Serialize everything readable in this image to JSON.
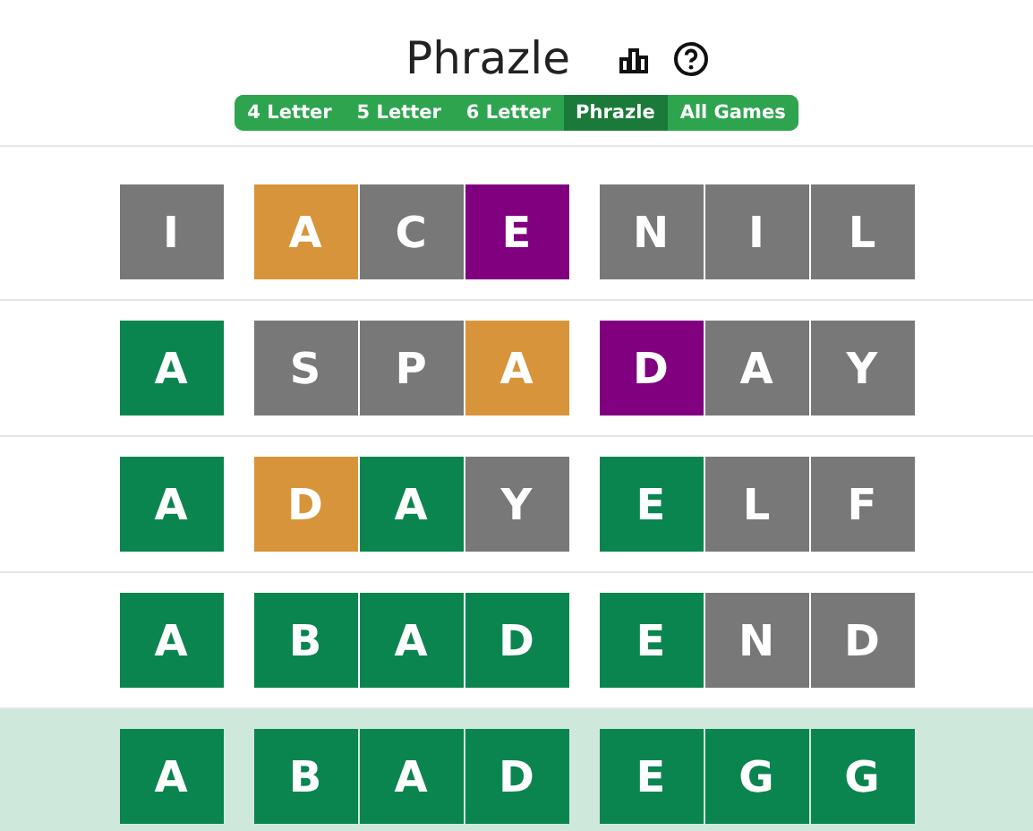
{
  "title": "Phrazle",
  "tabs": [
    {
      "label": "4 Letter",
      "selected": false
    },
    {
      "label": "5 Letter",
      "selected": false
    },
    {
      "label": "6 Letter",
      "selected": false
    },
    {
      "label": "Phrazle",
      "selected": true
    },
    {
      "label": "All Games",
      "selected": false
    }
  ],
  "rows": [
    {
      "selected": false,
      "words": [
        [
          {
            "letter": "I",
            "color": "#787878"
          }
        ],
        [
          {
            "letter": "A",
            "color": "#d8943a"
          },
          {
            "letter": "C",
            "color": "#787878"
          },
          {
            "letter": "E",
            "color": "#800080"
          }
        ],
        [
          {
            "letter": "N",
            "color": "#787878"
          },
          {
            "letter": "I",
            "color": "#787878"
          },
          {
            "letter": "L",
            "color": "#787878"
          }
        ]
      ]
    },
    {
      "selected": false,
      "words": [
        [
          {
            "letter": "A",
            "color": "#0a8550"
          }
        ],
        [
          {
            "letter": "S",
            "color": "#787878"
          },
          {
            "letter": "P",
            "color": "#787878"
          },
          {
            "letter": "A",
            "color": "#d8943a"
          }
        ],
        [
          {
            "letter": "D",
            "color": "#800080"
          },
          {
            "letter": "A",
            "color": "#787878"
          },
          {
            "letter": "Y",
            "color": "#787878"
          }
        ]
      ]
    },
    {
      "selected": false,
      "words": [
        [
          {
            "letter": "A",
            "color": "#0a8550"
          }
        ],
        [
          {
            "letter": "D",
            "color": "#d8943a"
          },
          {
            "letter": "A",
            "color": "#0a8550"
          },
          {
            "letter": "Y",
            "color": "#787878"
          }
        ],
        [
          {
            "letter": "E",
            "color": "#0a8550"
          },
          {
            "letter": "L",
            "color": "#787878"
          },
          {
            "letter": "F",
            "color": "#787878"
          }
        ]
      ]
    },
    {
      "selected": false,
      "words": [
        [
          {
            "letter": "A",
            "color": "#0a8550"
          }
        ],
        [
          {
            "letter": "B",
            "color": "#0a8550"
          },
          {
            "letter": "A",
            "color": "#0a8550"
          },
          {
            "letter": "D",
            "color": "#0a8550"
          }
        ],
        [
          {
            "letter": "E",
            "color": "#0a8550"
          },
          {
            "letter": "N",
            "color": "#787878"
          },
          {
            "letter": "D",
            "color": "#787878"
          }
        ]
      ]
    },
    {
      "selected": true,
      "words": [
        [
          {
            "letter": "A",
            "color": "#0a8550"
          }
        ],
        [
          {
            "letter": "B",
            "color": "#0a8550"
          },
          {
            "letter": "A",
            "color": "#0a8550"
          },
          {
            "letter": "D",
            "color": "#0a8550"
          }
        ],
        [
          {
            "letter": "E",
            "color": "#0a8550"
          },
          {
            "letter": "G",
            "color": "#0a8550"
          },
          {
            "letter": "G",
            "color": "#0a8550"
          }
        ]
      ]
    }
  ]
}
